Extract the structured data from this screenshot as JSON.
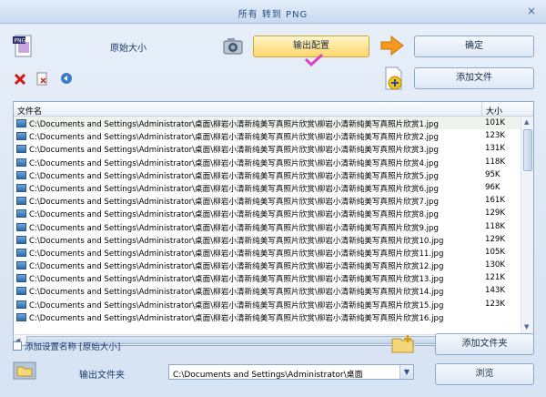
{
  "window": {
    "title": "所有 转到 PNG",
    "close_glyph": "×"
  },
  "top": {
    "size_label": "原始大小",
    "output_config_button": "输出配置",
    "ok_button": "确定",
    "add_file_button": "添加文件"
  },
  "table": {
    "columns": [
      "文件名",
      "大小"
    ],
    "rows": [
      [
        "C:\\Documents and Settings\\Administrator\\桌面\\柳岩小清新纯美写真照片欣赏\\柳岩小清新纯美写真照片欣赏1.jpg",
        "101K"
      ],
      [
        "C:\\Documents and Settings\\Administrator\\桌面\\柳岩小清新纯美写真照片欣赏\\柳岩小清新纯美写真照片欣赏2.jpg",
        "123K"
      ],
      [
        "C:\\Documents and Settings\\Administrator\\桌面\\柳岩小清新纯美写真照片欣赏\\柳岩小清新纯美写真照片欣赏3.jpg",
        "131K"
      ],
      [
        "C:\\Documents and Settings\\Administrator\\桌面\\柳岩小清新纯美写真照片欣赏\\柳岩小清新纯美写真照片欣赏4.jpg",
        "118K"
      ],
      [
        "C:\\Documents and Settings\\Administrator\\桌面\\柳岩小清新纯美写真照片欣赏\\柳岩小清新纯美写真照片欣赏5.jpg",
        "95K"
      ],
      [
        "C:\\Documents and Settings\\Administrator\\桌面\\柳岩小清新纯美写真照片欣赏\\柳岩小清新纯美写真照片欣赏6.jpg",
        "96K"
      ],
      [
        "C:\\Documents and Settings\\Administrator\\桌面\\柳岩小清新纯美写真照片欣赏\\柳岩小清新纯美写真照片欣赏7.jpg",
        "161K"
      ],
      [
        "C:\\Documents and Settings\\Administrator\\桌面\\柳岩小清新纯美写真照片欣赏\\柳岩小清新纯美写真照片欣赏8.jpg",
        "129K"
      ],
      [
        "C:\\Documents and Settings\\Administrator\\桌面\\柳岩小清新纯美写真照片欣赏\\柳岩小清新纯美写真照片欣赏9.jpg",
        "118K"
      ],
      [
        "C:\\Documents and Settings\\Administrator\\桌面\\柳岩小清新纯美写真照片欣赏\\柳岩小清新纯美写真照片欣赏10.jpg",
        "129K"
      ],
      [
        "C:\\Documents and Settings\\Administrator\\桌面\\柳岩小清新纯美写真照片欣赏\\柳岩小清新纯美写真照片欣赏11.jpg",
        "105K"
      ],
      [
        "C:\\Documents and Settings\\Administrator\\桌面\\柳岩小清新纯美写真照片欣赏\\柳岩小清新纯美写真照片欣赏12.jpg",
        "130K"
      ],
      [
        "C:\\Documents and Settings\\Administrator\\桌面\\柳岩小清新纯美写真照片欣赏\\柳岩小清新纯美写真照片欣赏13.jpg",
        "121K"
      ],
      [
        "C:\\Documents and Settings\\Administrator\\桌面\\柳岩小清新纯美写真照片欣赏\\柳岩小清新纯美写真照片欣赏14.jpg",
        "143K"
      ],
      [
        "C:\\Documents and Settings\\Administrator\\桌面\\柳岩小清新纯美写真照片欣赏\\柳岩小清新纯美写真照片欣赏15.jpg",
        "123K"
      ],
      [
        "C:\\Documents and Settings\\Administrator\\桌面\\柳岩小清新纯美写真照片欣赏\\柳岩小清新纯美写真照片欣赏16.jpg",
        ""
      ]
    ]
  },
  "bottom": {
    "add_setting_name_label": "添加设置名称 [原始大小]",
    "add_folder_button": "添加文件夹",
    "output_folder_label": "输出文件夹",
    "output_folder_value": "C:\\Documents and Settings\\Administrator\\桌面",
    "browse_button": "浏览"
  },
  "icons": {
    "png": "png-file-icon",
    "camera": "camera-icon",
    "arrow": "arrow-right-icon",
    "delete": "delete-icon",
    "clear": "clear-icon",
    "refresh": "refresh-icon",
    "add_file": "add-file-icon",
    "folder_add": "folder-add-icon",
    "folder": "folder-icon"
  },
  "colors": {
    "accent": "#ffd66a",
    "title": "#2a4f85",
    "check_mark": "#e040c0"
  }
}
